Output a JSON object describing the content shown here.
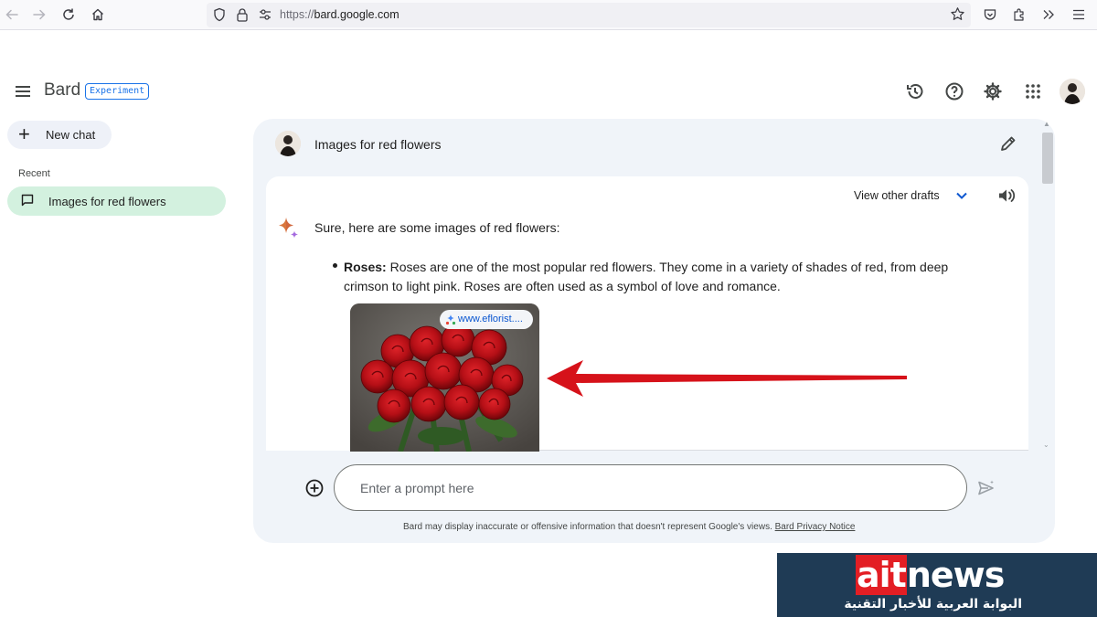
{
  "browser": {
    "url_prefix": "https://",
    "url_domain": "bard.google.com",
    "icons": [
      "back-arrow-icon",
      "forward-arrow-icon",
      "reload-icon",
      "home-icon",
      "shield-icon",
      "lock-icon",
      "permissions-icon",
      "bookmark-star-icon",
      "pocket-icon",
      "extensions-icon",
      "overflow-chevrons-icon",
      "hamburger-menu-icon"
    ]
  },
  "header": {
    "title": "Bard",
    "badge": "Experiment",
    "icons": [
      "history-icon",
      "help-icon",
      "settings-gear-icon",
      "apps-grid-icon",
      "profile-avatar"
    ]
  },
  "sidebar": {
    "new_chat_label": "New chat",
    "recent_heading": "Recent",
    "items": [
      {
        "label": "Images for red flowers",
        "active": true
      }
    ]
  },
  "conversation": {
    "query": "Images for red flowers",
    "drafts_label": "View other drafts",
    "intro": "Sure, here are some images of red flowers:",
    "bullets": [
      {
        "term": "Roses:",
        "text": " Roses are one of the most popular red flowers. They come in a variety of shades of red, from deep crimson to light pink. Roses are often used as a symbol of love and romance.",
        "image_source": "www.eflorist...."
      }
    ]
  },
  "prompt": {
    "placeholder": "Enter a prompt here"
  },
  "footer": {
    "disclaimer": "Bard may display inaccurate or offensive information that doesn't represent Google's views.",
    "privacy_link": "Bard Privacy Notice"
  },
  "watermark": {
    "brand_highlight": "ait",
    "brand_rest": "news",
    "tagline": "البوابة العربية للأخبار التقنية"
  },
  "colors": {
    "accent": "#1a73e8",
    "active_item": "#d3f1df",
    "panel_bg": "#f0f4f9",
    "annotation_arrow": "#d6121a",
    "watermark_bg": "#1f3b55"
  }
}
